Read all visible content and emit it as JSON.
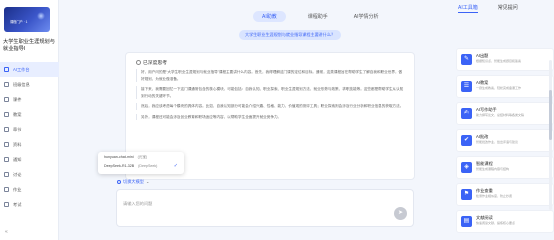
{
  "sidebar": {
    "logo_text": "课程门户 · 1",
    "course_title": "大学生职业生涯规划与就业指导I",
    "items": [
      {
        "label": "AI工作台",
        "icon": "robot-icon",
        "active": true
      },
      {
        "label": "班级信息",
        "icon": "class-icon",
        "active": false
      },
      {
        "label": "课件",
        "icon": "courseware-icon",
        "active": false
      },
      {
        "label": "教案",
        "icon": "lesson-plan-icon",
        "active": false
      },
      {
        "label": "章节",
        "icon": "chapter-icon",
        "active": false
      },
      {
        "label": "资料",
        "icon": "material-icon",
        "active": false
      },
      {
        "label": "通知",
        "icon": "notice-icon",
        "active": false
      },
      {
        "label": "讨论",
        "icon": "discussion-icon",
        "active": false
      },
      {
        "label": "作业",
        "icon": "homework-icon",
        "active": false
      },
      {
        "label": "考试",
        "icon": "exam-icon",
        "active": false
      }
    ]
  },
  "tabs": [
    {
      "label": "AI助教",
      "active": true
    },
    {
      "label": "课程助手",
      "active": false
    },
    {
      "label": "AI学情分析",
      "active": false
    }
  ],
  "question": "大学生职业生涯规划与就业指导课程主要讲什么？",
  "answer": {
    "header": "已深度思考",
    "paragraphs": [
      "好，用户问的是“大学生职业生涯规划与就业指导”课程主要讲什么内容。首先，我得理解这门课的定位和目标。通常，这类课程旨在帮助学生了解自我和职业世界，做好规划，为就业做准备。",
      "接下来，我需要回忆一下这门课通常包含的核心模块。可能包括：自我认知、职业探索、职业生涯规划方法、就业形势与政策、求职技能等。这些都是帮助学生从认知到行动的关键环节。",
      "然后，我应该考虑每个模块的具体内容。比如，自我认知部分可能会介绍兴趣、性格、能力、价值观的测评工具；职业探索则会涉及行业分析和职业信息的获取方法。",
      "另外，课程还可能会涉及创业教育和职场适应等内容，以帮助学生全面提升就业竞争力。"
    ]
  },
  "model_dropdown": {
    "options": [
      {
        "name": "hunyuan-chat-mini",
        "tag": "(元宝)"
      },
      {
        "name": "DeepSeek-R1-32B",
        "tag": "(DeepSeek)"
      }
    ],
    "selected_index": 1
  },
  "model_select_label": "切换大模型",
  "input": {
    "placeholder": "请输入您的问题",
    "value": ""
  },
  "top_tabs": [
    {
      "label": "AI工具箱",
      "active": true
    },
    {
      "label": "常见提问",
      "active": false
    }
  ],
  "tools": [
    {
      "name": "AI出题",
      "desc": "根据知识点，智能生成题目和答案",
      "icon": "quiz-icon"
    },
    {
      "name": "AI教案",
      "desc": "一键生成教案，轻松完成备课工作",
      "icon": "lesson-icon"
    },
    {
      "name": "AI写作助手",
      "desc": "助力撰写论文、总结材料等各类文稿",
      "icon": "writing-icon"
    },
    {
      "name": "AI批改",
      "desc": "智能批改作业，给出评语与建议",
      "icon": "grading-icon"
    },
    {
      "name": "智能课程",
      "desc": "智能生成课程内容与结构",
      "icon": "smart-course-icon"
    },
    {
      "name": "作业查重",
      "desc": "检测作业相似度，防止抄袭",
      "icon": "check-icon"
    },
    {
      "name": "文献阅读",
      "desc": "快速阅读文献，提炼核心要点",
      "icon": "reading-icon"
    }
  ]
}
